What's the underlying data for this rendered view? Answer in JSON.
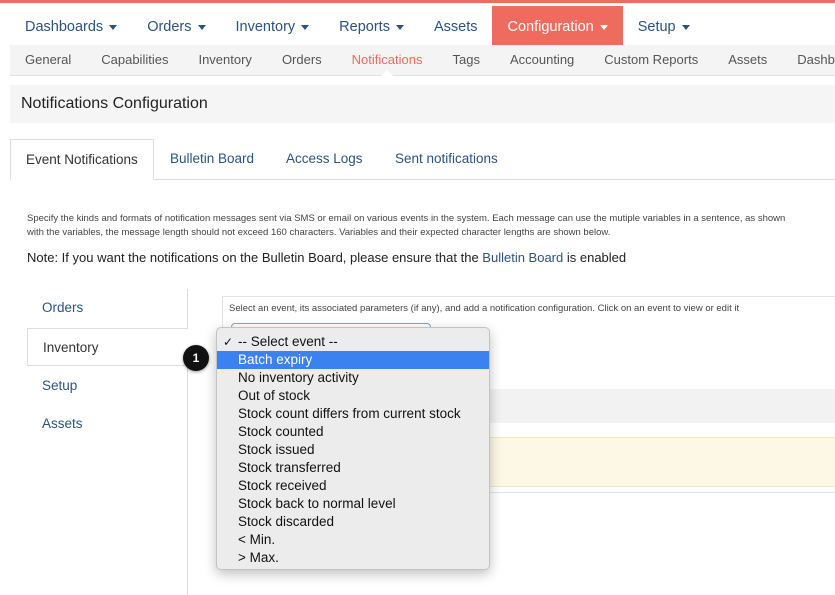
{
  "topnav": {
    "items": [
      {
        "label": "Dashboards",
        "caret": true
      },
      {
        "label": "Orders",
        "caret": true
      },
      {
        "label": "Inventory",
        "caret": true
      },
      {
        "label": "Reports",
        "caret": true
      },
      {
        "label": "Assets",
        "caret": false
      },
      {
        "label": "Configuration",
        "caret": true,
        "active": true
      },
      {
        "label": "Setup",
        "caret": true
      }
    ]
  },
  "subnav": {
    "items": [
      "General",
      "Capabilities",
      "Inventory",
      "Orders",
      "Notifications",
      "Tags",
      "Accounting",
      "Custom Reports",
      "Assets",
      "Dashboard"
    ],
    "active": "Notifications"
  },
  "page": {
    "title": "Notifications Configuration"
  },
  "tabs": {
    "items": [
      "Event Notifications",
      "Bulletin Board",
      "Access Logs",
      "Sent notifications"
    ],
    "active": "Event Notifications"
  },
  "description": {
    "line1": "Specify the kinds and formats of notification messages sent via SMS or email on various events in the system. Each message can use the mutiple variables in a sentence, as shown",
    "line2": "with the variables, the message length should not exceed 160 characters. Variables and their expected character lengths are shown below."
  },
  "note": {
    "prefix": "Note: If you want the notifications on the Bulletin Board, please ensure that the ",
    "link": "Bulletin Board",
    "suffix": " is enabled"
  },
  "sidenav": {
    "items": [
      "Orders",
      "Inventory",
      "Setup",
      "Assets"
    ],
    "active": "Inventory"
  },
  "panel": {
    "instruction": "Select an event, its associated parameters (if any), and add a notification configuration. Click on an event to view or edit it"
  },
  "dropdown": {
    "selected": "-- Select event --",
    "highlighted": "Batch expiry",
    "options": [
      "-- Select event --",
      "Batch expiry",
      "No inventory activity",
      "Out of stock",
      "Stock count differs from current stock",
      "Stock counted",
      "Stock issued",
      "Stock transferred",
      "Stock received",
      "Stock back to normal level",
      "Stock discarded",
      "< Min.",
      "> Max."
    ]
  },
  "marker": {
    "label": "1"
  },
  "colors": {
    "accent": "#ef6b5e",
    "link": "#2a5482",
    "highlight": "#3b82f0"
  }
}
